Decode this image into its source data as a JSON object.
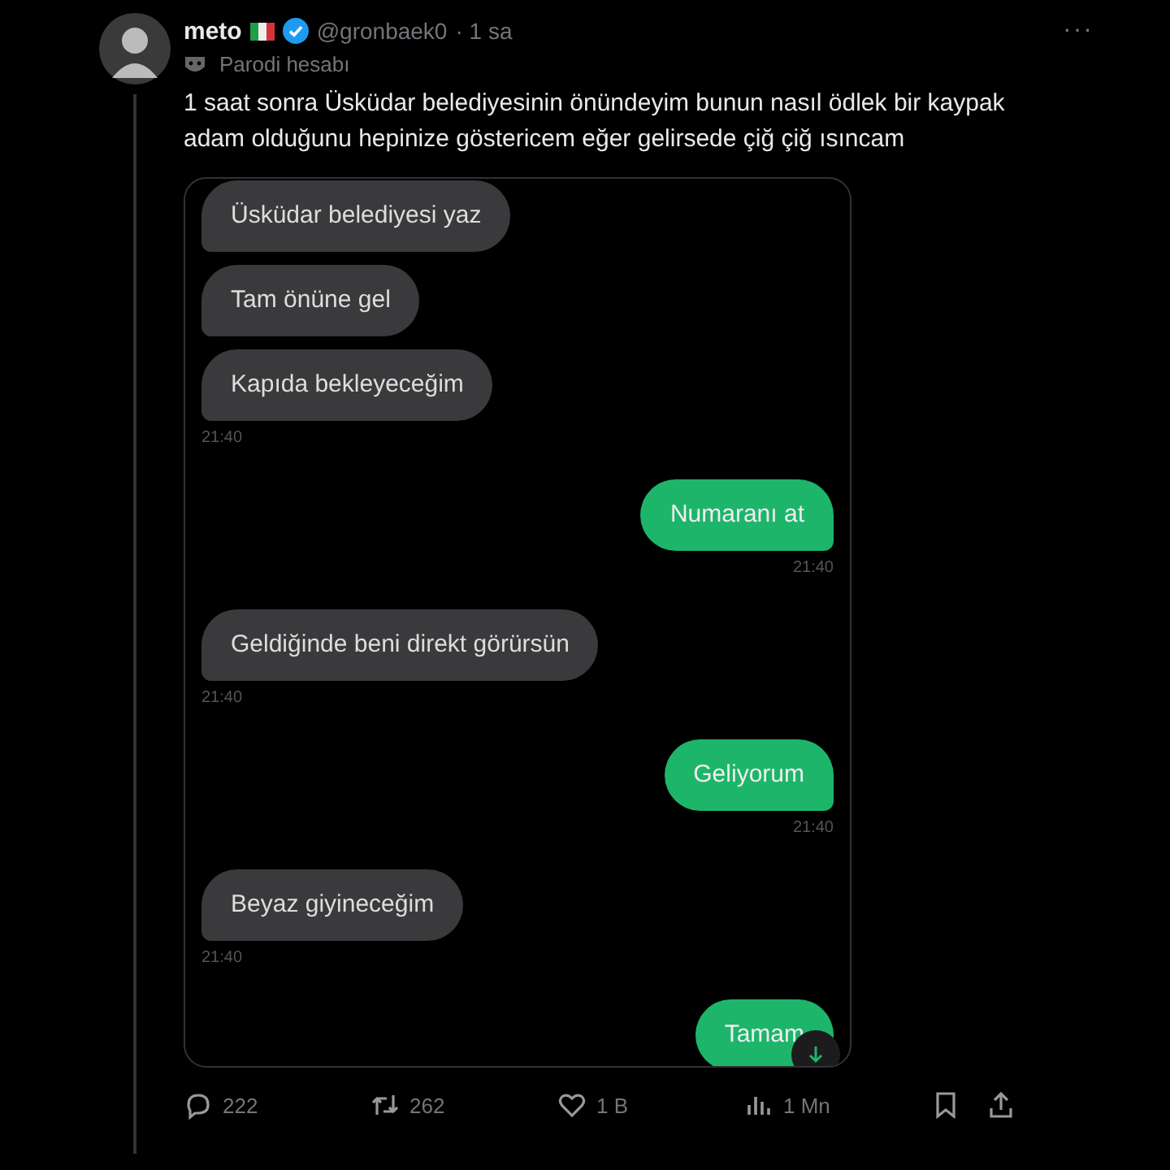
{
  "tweet": {
    "name": "meto",
    "handle": "@gronbaek0",
    "time": "· 1 sa",
    "label": "Parodi hesabı",
    "text": "1 saat sonra Üsküdar belediyesinin önündeyim bunun nasıl ödlek bir kaypak adam olduğunu hepinize göstericem eğer gelirsede çiğ çiğ ısıncam",
    "more": "···"
  },
  "chat": {
    "messages": [
      {
        "kind": "in",
        "text": "Üsküdar belediyesi yaz"
      },
      {
        "kind": "in",
        "text": "Tam önüne gel"
      },
      {
        "kind": "in",
        "text": "Kapıda bekleyeceğim",
        "time": "21:40"
      },
      {
        "kind": "out",
        "text": "Numaranı at",
        "time": "21:40"
      },
      {
        "kind": "in",
        "text": "Geldiğinde beni direkt görürsün",
        "time": "21:40"
      },
      {
        "kind": "out",
        "text": "Geliyorum",
        "time": "21:40"
      },
      {
        "kind": "in",
        "text": "Beyaz giyineceğim",
        "time": "21:40"
      },
      {
        "kind": "out",
        "text": "Tamam"
      }
    ]
  },
  "actions": {
    "replies": "222",
    "reposts": "262",
    "likes": "1 B",
    "views": "1 Mn"
  }
}
